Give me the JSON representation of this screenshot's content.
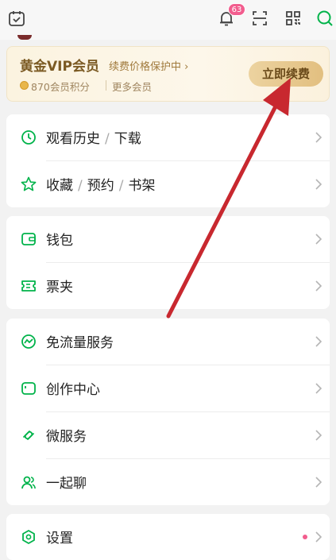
{
  "topbar": {
    "icons": [
      "calendar-check-icon",
      "bell-icon",
      "scan-icon",
      "qr-code-icon",
      "search-icon"
    ],
    "notification_count": "63"
  },
  "vip": {
    "title": "黄金VIP会员",
    "subtitle": "续费价格保护中 ›",
    "points": "870会员积分",
    "more": "更多会员",
    "renew_button": "立即续费"
  },
  "sections": [
    {
      "items": [
        {
          "parts": [
            "观看历史",
            "下载"
          ],
          "icon": "clock-icon"
        },
        {
          "parts": [
            "收藏",
            "预约",
            "书架"
          ],
          "icon": "star-icon"
        }
      ]
    },
    {
      "items": [
        {
          "label": "钱包",
          "icon": "wallet-icon"
        },
        {
          "label": "票夹",
          "icon": "ticket-icon"
        }
      ]
    },
    {
      "items": [
        {
          "label": "免流量服务",
          "icon": "traffic-icon"
        },
        {
          "label": "创作中心",
          "icon": "creator-icon"
        },
        {
          "label": "微服务",
          "icon": "micro-service-icon"
        },
        {
          "label": "一起聊",
          "icon": "chat-people-icon"
        }
      ]
    },
    {
      "items": [
        {
          "label": "设置",
          "icon": "settings-icon"
        }
      ]
    }
  ],
  "colors": {
    "accent": "#00b34a",
    "vip_gold": "#7b5a23",
    "badge": "#f25d8e",
    "annotation_arrow": "#c8282f"
  }
}
